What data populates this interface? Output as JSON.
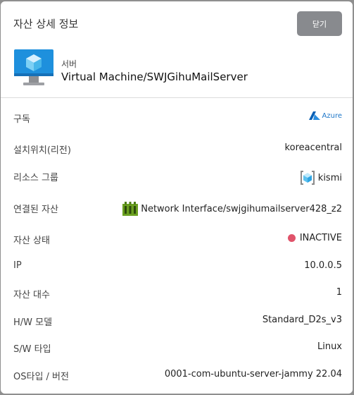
{
  "modal": {
    "title": "자산 상세 정보",
    "close_label": "닫기"
  },
  "asset": {
    "type_label": "서버",
    "name": "Virtual Machine/SWJGihuMailServer",
    "icon": "virtual-machine-icon"
  },
  "details": {
    "subscription": {
      "label": "구독",
      "value": "Azure",
      "icon": "azure-logo"
    },
    "location": {
      "label": "설치위치(리전)",
      "value": "koreacentral"
    },
    "resource_group": {
      "label": "리소스 그룹",
      "value": "kismi",
      "icon": "resource-group-icon"
    },
    "linked_asset": {
      "label": "연결된 자산",
      "value": "Network Interface/swjgihumailserver428_z2",
      "icon": "network-interface-icon"
    },
    "status": {
      "label": "자산 상태",
      "value": "INACTIVE",
      "color": "#e0536a"
    },
    "ip": {
      "label": "IP",
      "value": "10.0.0.5"
    },
    "count": {
      "label": "자산 대수",
      "value": "1"
    },
    "hw_model": {
      "label": "H/W 모델",
      "value": "Standard_D2s_v3"
    },
    "sw_type": {
      "label": "S/W 타입",
      "value": "Linux"
    },
    "os_version": {
      "label": "OS타입 / 버전",
      "value": "0001-com-ubuntu-server-jammy 22.04"
    }
  }
}
